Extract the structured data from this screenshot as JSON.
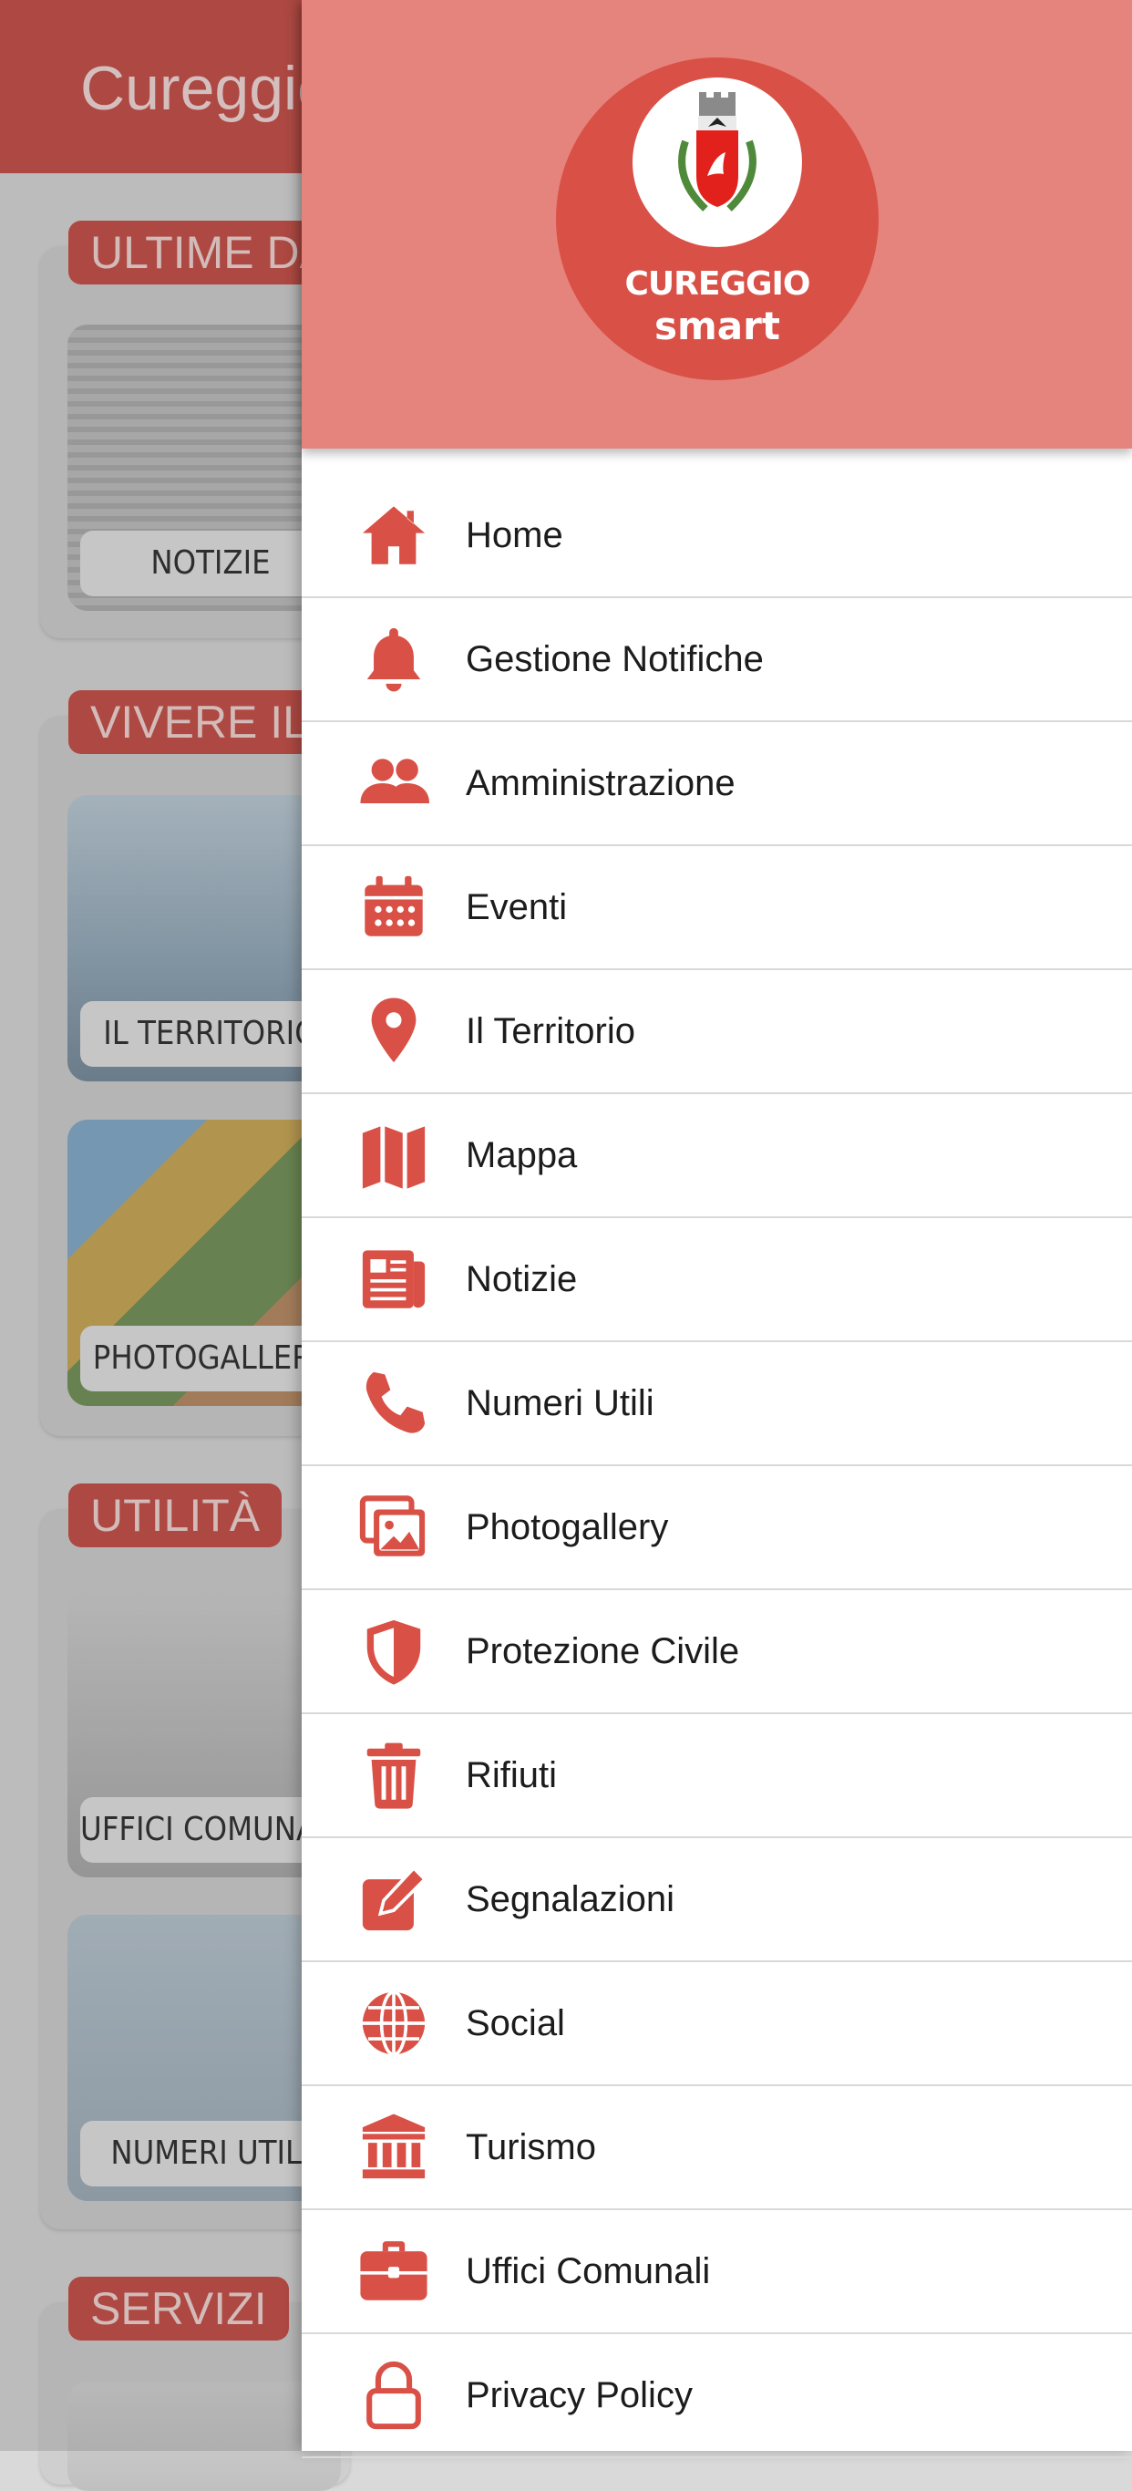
{
  "app": {
    "title": "Cureggio",
    "accent": "#c4433b"
  },
  "background": {
    "sections": [
      {
        "title": "ULTIME DA",
        "tiles": [
          "NOTIZIE"
        ]
      },
      {
        "title": "VIVERE IL",
        "tiles": [
          "IL TERRITORIO",
          "PHOTOGALLERY"
        ]
      },
      {
        "title": "UTILITÀ",
        "tiles": [
          "UFFICI COMUNALI",
          "NUMERI UTILI"
        ]
      },
      {
        "title": "SERVIZI",
        "tiles": []
      }
    ]
  },
  "drawer": {
    "logo_line1": "CUREGGIO",
    "logo_line2": "smart",
    "header_color": "#e5847c",
    "icon_color": "#d95046",
    "items": [
      {
        "label": "Home",
        "icon": "home-icon"
      },
      {
        "label": "Gestione Notifiche",
        "icon": "bell-icon"
      },
      {
        "label": "Amministrazione",
        "icon": "users-icon"
      },
      {
        "label": "Eventi",
        "icon": "calendar-icon"
      },
      {
        "label": "Il Territorio",
        "icon": "map-pin-icon"
      },
      {
        "label": "Mappa",
        "icon": "map-icon"
      },
      {
        "label": "Notizie",
        "icon": "newspaper-icon"
      },
      {
        "label": "Numeri Utili",
        "icon": "phone-icon"
      },
      {
        "label": "Photogallery",
        "icon": "images-icon"
      },
      {
        "label": "Protezione Civile",
        "icon": "shield-icon"
      },
      {
        "label": "Rifiuti",
        "icon": "trash-icon"
      },
      {
        "label": "Segnalazioni",
        "icon": "edit-icon"
      },
      {
        "label": "Social",
        "icon": "globe-icon"
      },
      {
        "label": "Turismo",
        "icon": "landmark-icon"
      },
      {
        "label": "Uffici Comunali",
        "icon": "briefcase-icon"
      },
      {
        "label": "Privacy Policy",
        "icon": "lock-icon"
      }
    ]
  }
}
